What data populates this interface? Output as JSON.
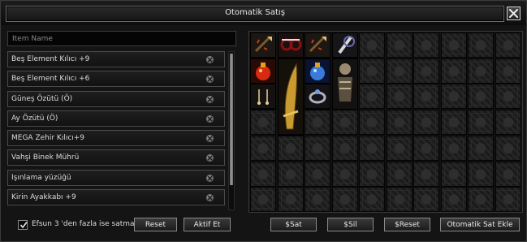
{
  "window": {
    "title": "Otomatik Satış"
  },
  "search": {
    "placeholder": "İtem Name",
    "value": ""
  },
  "items": [
    {
      "label": "Beş Element Kılıcı +9"
    },
    {
      "label": "Beş Element Kılıcı +6"
    },
    {
      "label": "Güneş Özütü (Ö)"
    },
    {
      "label": "Ay Özütü (Ö)"
    },
    {
      "label": "MEGA Zehir Kılıcı+9"
    },
    {
      "label": "Vahşi Binek Mührü"
    },
    {
      "label": "Işınlama yüzüğü"
    },
    {
      "label": "Kirin Ayakkabı +9"
    }
  ],
  "options": {
    "checkbox_label": "Efsun 3 'den fazla ise satma",
    "checked": true
  },
  "buttons": {
    "reset": "Reset",
    "activate": "Aktif Et",
    "sell": "$Sat",
    "delete": "$Sil",
    "money_reset": "$Reset",
    "auto_sell_add": "Otomatik Sat Ekle"
  },
  "inventory": {
    "columns": 10,
    "rows": 7,
    "occupied": [
      {
        "name": "throwing-weapon-icon",
        "color": "#7a5a2a"
      },
      {
        "name": "red-glasses-item-icon",
        "color": "#8a1010"
      },
      {
        "name": "throwing-weapon-icon",
        "color": "#7a5a2a"
      },
      {
        "name": "white-fang-item-icon",
        "color": "#d8d8d8"
      },
      {
        "name": "red-potion-icon",
        "color": "#d82a10"
      },
      {
        "name": "golden-blade-icon",
        "color": "#c89a30"
      },
      {
        "name": "blue-potion-icon",
        "color": "#3a7ad8"
      },
      {
        "name": "armored-warrior-icon",
        "color": "#9a8a70"
      },
      {
        "name": "earrings-icon",
        "color": "#b8a070"
      },
      {
        "name": "ring-icon",
        "color": "#b0b0c0"
      }
    ]
  },
  "colors": {
    "background": "#141414",
    "border": "#4a4a4a",
    "text": "#dcdcdc"
  }
}
